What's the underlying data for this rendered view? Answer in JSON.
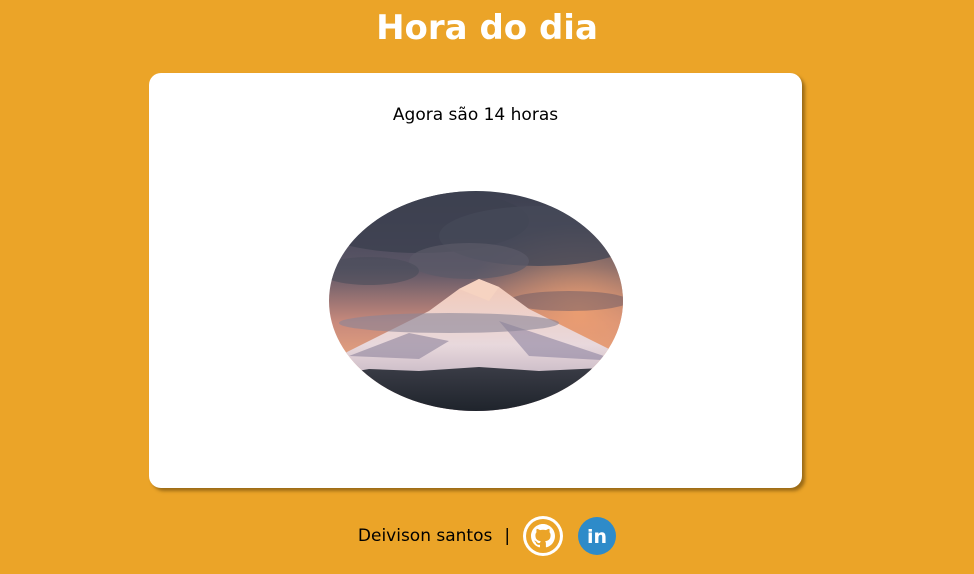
{
  "header": {
    "title": "Hora do dia"
  },
  "main": {
    "hour_text": "Agora são 14 horas",
    "image": {
      "description_icon": "mountain-sunset-image"
    }
  },
  "footer": {
    "author": "Deivison santos",
    "separator": "|",
    "links": [
      {
        "icon": "github-icon"
      },
      {
        "icon": "linkedin-icon",
        "glyph": "in"
      }
    ]
  },
  "colors": {
    "background": "#EBA428",
    "card": "#FFFFFF",
    "title": "#FFFFFF",
    "linkedin": "#2E8BC9"
  }
}
